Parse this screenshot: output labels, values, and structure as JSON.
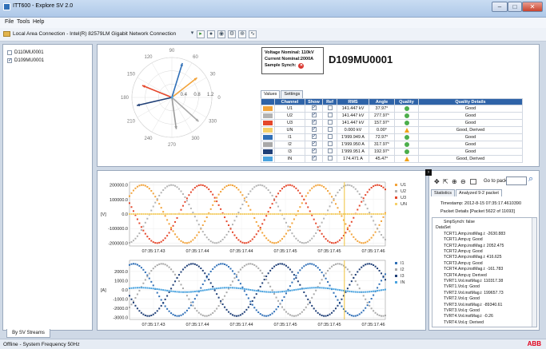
{
  "window": {
    "title": "ITT600 - Explore SV 2.0",
    "min": "–",
    "max": "□",
    "close": "✕"
  },
  "menu": [
    "File",
    "Tools",
    "Help"
  ],
  "toolbar": {
    "connection": "Local Area Connection - Intel(R) 82579LM Gigabit Network Connection"
  },
  "streams": [
    {
      "name": "D110MU0001",
      "checked": false
    },
    {
      "name": "D109MU0001",
      "checked": true
    }
  ],
  "left_tab": "By SV Streams",
  "polar": {
    "rings": [
      "0.4",
      "0.8",
      "1.2"
    ],
    "angles": [
      "90",
      "60",
      "30",
      "0",
      "330",
      "300",
      "270",
      "240",
      "210",
      "180",
      "150",
      "120"
    ],
    "phasors": [
      {
        "name": "U1",
        "angle": 37.97,
        "mag": 0.8,
        "color": "#f2a33a"
      },
      {
        "name": "U2",
        "angle": 277.97,
        "mag": 0.8,
        "color": "#9a9a9a"
      },
      {
        "name": "U3",
        "angle": 157.97,
        "mag": 0.8,
        "color": "#e5472b"
      },
      {
        "name": "I1",
        "angle": 72.97,
        "mag": 0.9,
        "color": "#2f6fb7"
      },
      {
        "name": "I2",
        "angle": 317.97,
        "mag": 0.9,
        "color": "#a9a9a9"
      },
      {
        "name": "I3",
        "angle": 192.97,
        "mag": 0.9,
        "color": "#1f3f77"
      },
      {
        "name": "IN",
        "angle": 45.47,
        "mag": 0.05,
        "color": "#4aa3df"
      }
    ]
  },
  "info": {
    "voltage": "Voltage Nominal: 110kV",
    "current": "Current Nominal:2000A",
    "sync": "Sample Synch:",
    "sync_icon": "✕"
  },
  "mu_title": "D109MU0001",
  "value_tabs": [
    "Values",
    "Settings"
  ],
  "table": {
    "headers": [
      "Channel",
      "Show",
      "Ref",
      "RMS",
      "Angle",
      "Quality",
      "Quality Details"
    ],
    "rows": [
      {
        "color": "#f2a33a",
        "channel": "U1",
        "show": true,
        "ref": false,
        "rms": "141.447 kV",
        "angle": "37.97°",
        "quality": "ok",
        "details": "Good"
      },
      {
        "color": "#b3b3b3",
        "channel": "U2",
        "show": true,
        "ref": false,
        "rms": "141.447 kV",
        "angle": "277.97°",
        "quality": "ok",
        "details": "Good"
      },
      {
        "color": "#e5472b",
        "channel": "U3",
        "show": true,
        "ref": false,
        "rms": "141.447 kV",
        "angle": "157.97°",
        "quality": "ok",
        "details": "Good"
      },
      {
        "color": "#f5d06a",
        "channel": "UN",
        "show": true,
        "ref": false,
        "rms": "0.000 kV",
        "angle": "0.00°",
        "quality": "warn",
        "details": "Good, Derived"
      },
      {
        "color": "#2f6fb7",
        "channel": "I1",
        "show": true,
        "ref": false,
        "rms": "1'999.949 A",
        "angle": "72.97°",
        "quality": "ok",
        "details": "Good"
      },
      {
        "color": "#a9a9a9",
        "channel": "I2",
        "show": true,
        "ref": false,
        "rms": "1'999.950 A",
        "angle": "317.97°",
        "quality": "ok",
        "details": "Good"
      },
      {
        "color": "#1f3f77",
        "channel": "I3",
        "show": true,
        "ref": false,
        "rms": "1'999.951 A",
        "angle": "192.97°",
        "quality": "ok",
        "details": "Good"
      },
      {
        "color": "#4aa3df",
        "channel": "IN",
        "show": true,
        "ref": false,
        "rms": "174.471 A",
        "angle": "45.47°",
        "quality": "warn",
        "details": "Good, Derived"
      }
    ]
  },
  "chart_data": [
    {
      "type": "scatter",
      "title": "",
      "ylabel": "[V]",
      "ylim": [
        -220000,
        220000
      ],
      "yticks": [
        "200000.0",
        "100000.0",
        "0.0",
        "-100000.0",
        "-200000.0"
      ],
      "xticks": [
        "07:35:17.43",
        "07:35:17.44",
        "07:35:17.44",
        "07:35:17.45",
        "07:35:17.45",
        "07:35:17.46"
      ],
      "series": [
        {
          "name": "U1",
          "color": "#f2a33a",
          "amplitude": 200000,
          "phase_deg": 37.97
        },
        {
          "name": "U2",
          "color": "#b3b3b3",
          "amplitude": 200000,
          "phase_deg": 277.97
        },
        {
          "name": "U3",
          "color": "#e5472b",
          "amplitude": 200000,
          "phase_deg": 157.97
        },
        {
          "name": "UN",
          "color": "#f5d06a",
          "amplitude": 0,
          "phase_deg": 0
        }
      ],
      "cycles": 2.9,
      "cursor_fraction": 0.84
    },
    {
      "type": "scatter",
      "title": "",
      "ylabel": "[A]",
      "ylim": [
        -3200,
        3200
      ],
      "yticks": [
        "2000.0",
        "1000.0",
        "0.0",
        "-1000.0",
        "-2000.0",
        "-3000.0"
      ],
      "xticks": [
        "07:35:17.43",
        "07:35:17.44",
        "07:35:17.44",
        "07:35:17.45",
        "07:35:17.45",
        "07:35:17.46"
      ],
      "series": [
        {
          "name": "I1",
          "color": "#2f6fb7",
          "amplitude": 2828,
          "phase_deg": 72.97
        },
        {
          "name": "I2",
          "color": "#a9a9a9",
          "amplitude": 2828,
          "phase_deg": 317.97
        },
        {
          "name": "I3",
          "color": "#1f3f77",
          "amplitude": 2828,
          "phase_deg": 192.97
        },
        {
          "name": "IN",
          "color": "#4aa3df",
          "amplitude": 240,
          "phase_deg": 45.47
        }
      ],
      "cycles": 2.9,
      "cursor_fraction": 0.84
    }
  ],
  "packet": {
    "goto_label": "Go to packet:",
    "tabs": [
      "Statistics",
      "Analyzed 9-2 packet"
    ],
    "timestamp": "Timestamp: 2012-8-15 07:35:17.4610390",
    "details_header": "Packet Details [Packet 5622 of 11693]",
    "tree": [
      "SmpSynch: false",
      "DataSet",
      "TCRT1.Amp.instMag.i: -2630.883",
      "TCRT1.Amp.q: Good",
      "TCRT2.Amp.instMag.i: 2052.475",
      "TCRT2.Amp.q: Good",
      "TCRT3.Amp.instMag.i: 416.625",
      "TCRT3.Amp.q: Good",
      "TCRT4.Amp.instMag.i: -161.783",
      "TCRT4.Amp.q: Derived",
      "TVRT1.Vol.instMag.i: 110317.38",
      "TVRT1.Vol.q: Good",
      "TVRT2.Vol.instMag.i: 199657.73",
      "TVRT2.Vol.q: Good",
      "TVRT3.Vol.instMag.i: -89340.61",
      "TVRT3.Vol.q: Good",
      "TVRT4.Vol.instMag.i: -0.26",
      "TVRT4.Vol.q: Derived"
    ]
  },
  "status": {
    "text": "Offline -   System Frequency 50Hz",
    "logo": "ABB"
  }
}
